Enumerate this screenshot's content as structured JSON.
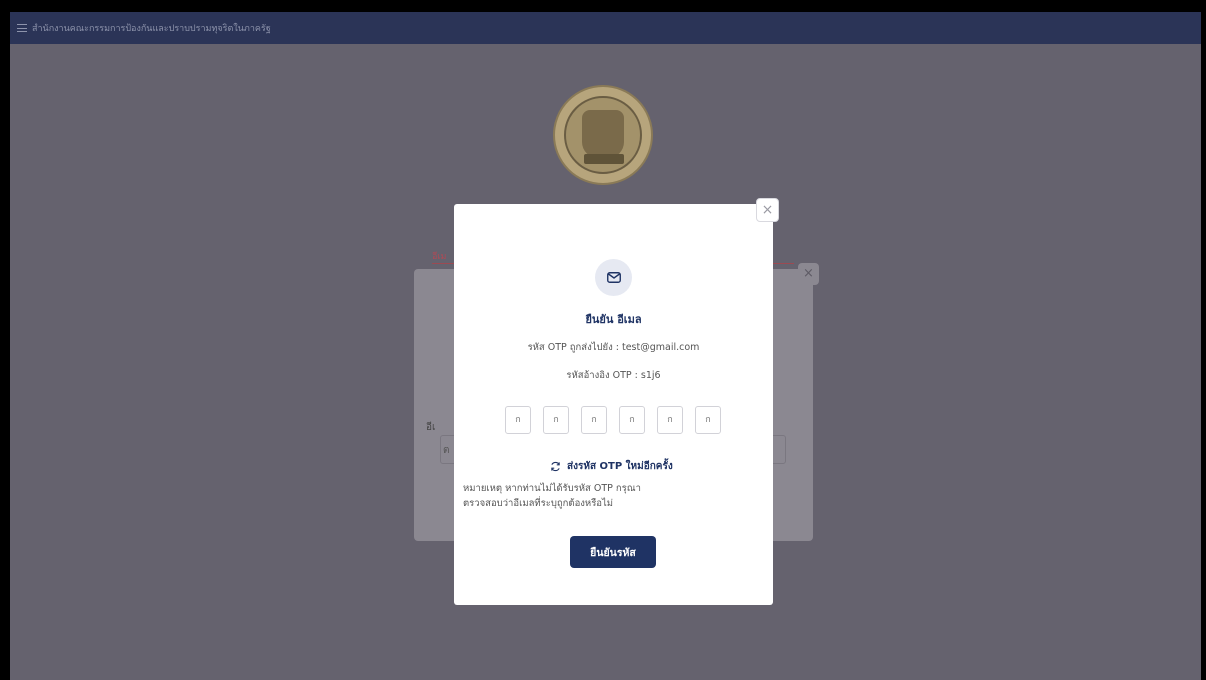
{
  "header": {
    "menu_icon": "menu-icon",
    "title": "สำนักงานคณะกรรมการป้องกันและปราบปรามทุจริตในภาครัฐ"
  },
  "dialog": {
    "close_label": "×",
    "icon": "mail-icon",
    "title": "ยืนยัน อีเมล",
    "sent_to": "รหัส OTP ถูกส่งไปยัง : test@gmail.com",
    "reference": "รหัสอ้างอิง OTP : s1j6",
    "otp_placeholder": "ก",
    "resend_icon": "refresh-icon",
    "resend_label": "ส่งรหัส OTP ใหม่อีกครั้ง",
    "note_line1": "หมายเหตุ หากท่านไม่ได้รับรหัส OTP กรุณา",
    "note_line2": "ตรวจสอบว่าอีเมลที่ระบุถูกต้องหรือไม่",
    "confirm_label": "ยืนยันรหัส"
  },
  "background": {
    "close_label": "×",
    "email_label": "อีเ",
    "red_label": "อีเม",
    "input_char": "ต"
  },
  "colors": {
    "primary": "#1f3364",
    "overlay": "#65626e",
    "topbar": "#2b3457"
  }
}
